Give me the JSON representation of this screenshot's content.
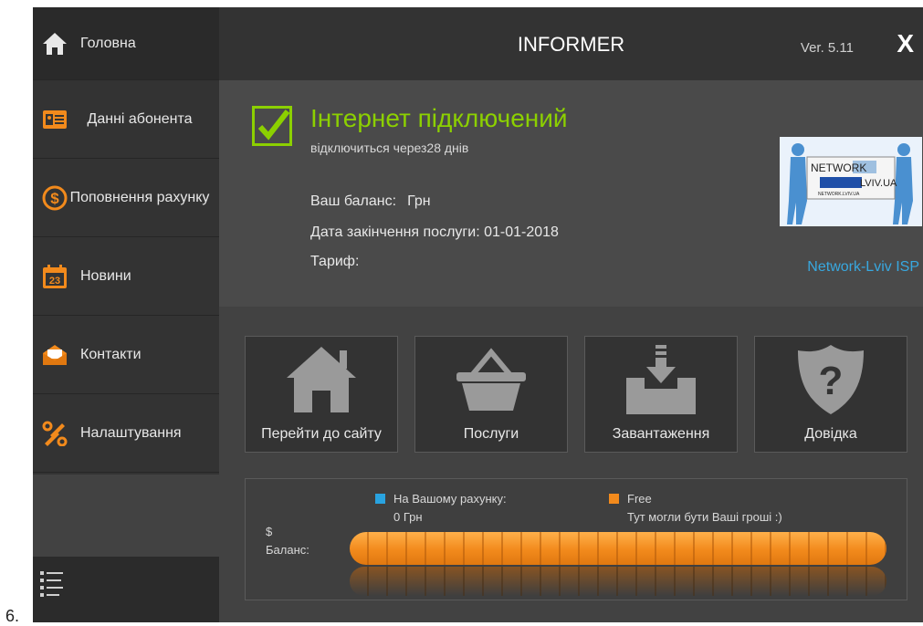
{
  "page_number": "6.",
  "header": {
    "title": "INFORMER",
    "version": "Ver. 5.11",
    "close_label": "X"
  },
  "sidebar": {
    "items": [
      {
        "label": "Головна",
        "icon": "home-icon"
      },
      {
        "label": "Данні абонента",
        "icon": "id-card-icon"
      },
      {
        "label": "Поповнення рахунку",
        "icon": "dollar-circle-icon"
      },
      {
        "label": "Новини",
        "icon": "calendar-icon"
      },
      {
        "label": "Контакти",
        "icon": "envelope-icon"
      },
      {
        "label": "Налаштування",
        "icon": "tools-icon"
      }
    ],
    "bottom_icon": "menu-list-icon"
  },
  "status": {
    "title": "Інтернет підключений",
    "subtitle": "відключиться через28 днів"
  },
  "account": {
    "balance_label": "Ваш баланс:",
    "balance_value": "Грн",
    "end_date_label": "Дата закінчення послуги:",
    "end_date_value": "01-01-2018",
    "tariff_label": "Тариф:",
    "tariff_value": ""
  },
  "isp": {
    "logo_line1": "NETWORK",
    "logo_line2": "LVIV.UA",
    "logo_line3": "NETWORK.LVIV.UA",
    "name": "Network-Lviv ISP"
  },
  "tiles": [
    {
      "label": "Перейти до сайту",
      "icon": "house-icon"
    },
    {
      "label": "Послуги",
      "icon": "basket-icon"
    },
    {
      "label": "Завантаження",
      "icon": "download-tray-icon"
    },
    {
      "label": "Довідка",
      "icon": "help-shield-icon"
    }
  ],
  "balance_widget": {
    "currency": "$",
    "label": "Баланс:",
    "legend": [
      {
        "name": "На Вашому рахунку:",
        "value": "0  Грн",
        "color": "#29a3e0"
      },
      {
        "name": "Free",
        "value": "Тут могли бути Ваші гроші :)",
        "color": "#f28a1c"
      }
    ],
    "account_fraction": 0
  },
  "colors": {
    "accent_green": "#8cd000",
    "accent_blue": "#29a3e0",
    "accent_orange": "#f28a1c"
  }
}
